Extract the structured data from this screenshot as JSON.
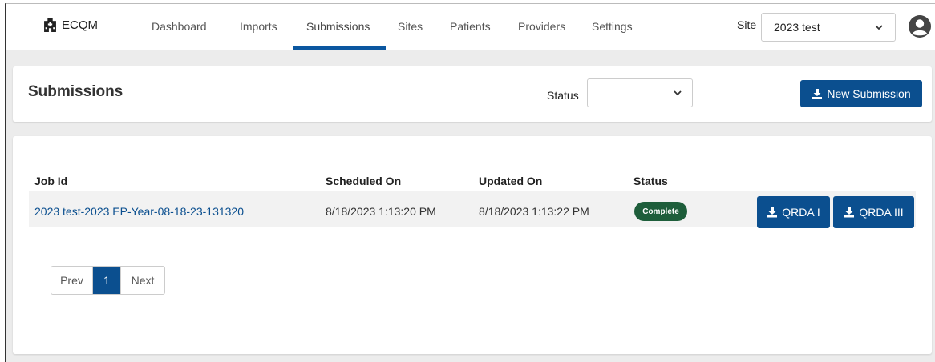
{
  "app": {
    "brand": "ECQM"
  },
  "nav": {
    "items": [
      {
        "label": "Dashboard"
      },
      {
        "label": "Imports"
      },
      {
        "label": "Submissions"
      },
      {
        "label": "Sites"
      },
      {
        "label": "Patients"
      },
      {
        "label": "Providers"
      },
      {
        "label": "Settings"
      }
    ],
    "active": "Submissions"
  },
  "site": {
    "label": "Site",
    "selected": "2023 test"
  },
  "header": {
    "title": "Submissions",
    "status_label": "Status",
    "status_selected": "",
    "new_button": "New Submission"
  },
  "table": {
    "columns": [
      "Job Id",
      "Scheduled On",
      "Updated On",
      "Status"
    ],
    "rows": [
      {
        "job_id": "2023 test-2023 EP-Year-08-18-23-131320",
        "scheduled_on": "8/18/2023 1:13:20 PM",
        "updated_on": "8/18/2023 1:13:22 PM",
        "status": "Complete",
        "btn_qrda1": "QRDA I",
        "btn_qrda3": "QRDA III"
      }
    ]
  },
  "pagination": {
    "prev": "Prev",
    "current": "1",
    "next": "Next"
  },
  "colors": {
    "primary": "#0b4f8f",
    "status_complete": "#1e5e3b"
  },
  "icons": [
    "hospital-icon",
    "chevron-down-icon",
    "user-circle-icon",
    "download-icon"
  ]
}
